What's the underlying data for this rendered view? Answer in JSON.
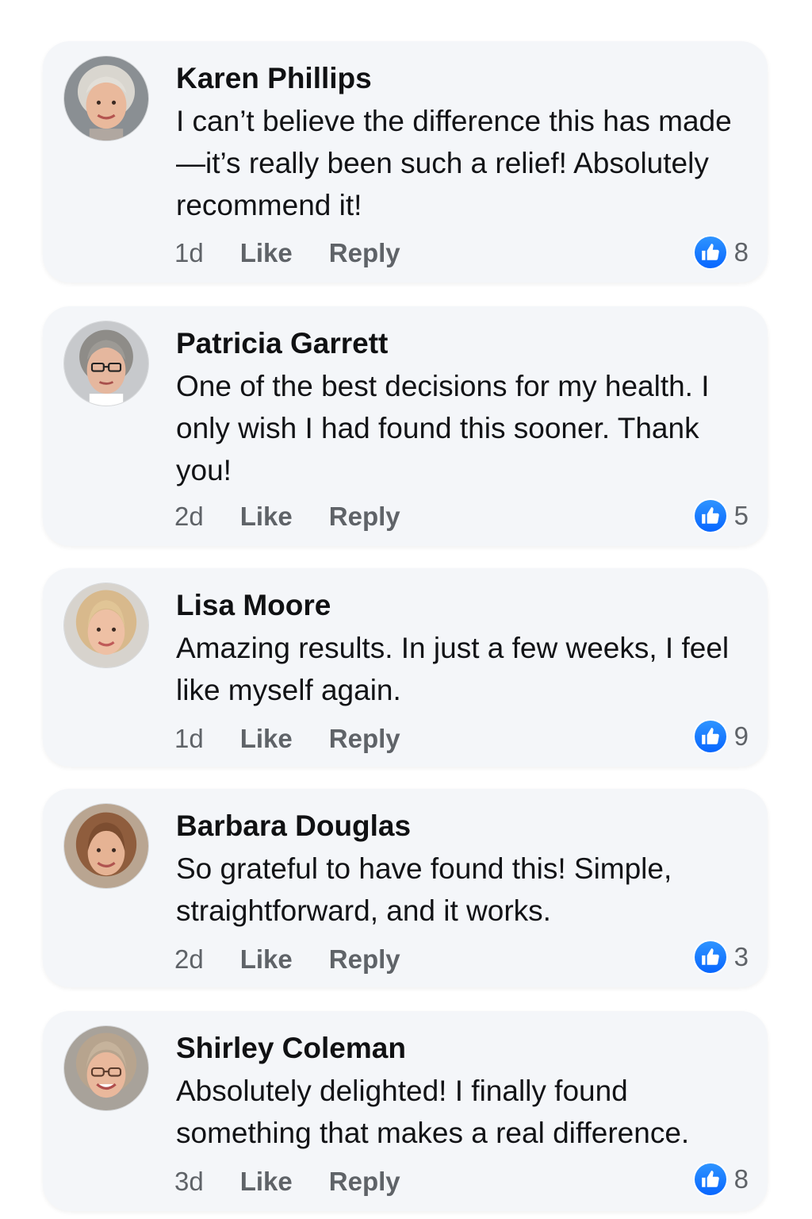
{
  "brand_colors": {
    "like_blue": "#0866ff",
    "card_background": "#f4f6f9",
    "meta_gray": "#5f6368"
  },
  "comments": [
    {
      "author": "Karen Phillips",
      "text": "I can’t believe the difference this has made—it’s really been such a relief! Absolutely recommend it!",
      "time": "1d",
      "like_label": "Like",
      "reply_label": "Reply",
      "reaction_icon": "thumbs-up-icon",
      "reaction_count": "8"
    },
    {
      "author": "Patricia Garrett",
      "text": "One of the best decisions for my health. I only wish I had found this sooner. Thank you!",
      "time": "2d",
      "like_label": "Like",
      "reply_label": "Reply",
      "reaction_icon": "thumbs-up-icon",
      "reaction_count": "5"
    },
    {
      "author": "Lisa Moore",
      "text": "Amazing results. In just a few weeks, I feel like myself again.",
      "time": "1d",
      "like_label": "Like",
      "reply_label": "Reply",
      "reaction_icon": "thumbs-up-icon",
      "reaction_count": "9"
    },
    {
      "author": "Barbara Douglas",
      "text": "So grateful to have found this! Simple, straightforward, and it works.",
      "time": "2d",
      "like_label": "Like",
      "reply_label": "Reply",
      "reaction_icon": "thumbs-up-icon",
      "reaction_count": "3"
    },
    {
      "author": "Shirley Coleman",
      "text": "Absolutely delighted! I finally found something that makes a real difference.",
      "time": "3d",
      "like_label": "Like",
      "reply_label": "Reply",
      "reaction_icon": "thumbs-up-icon",
      "reaction_count": "8"
    }
  ]
}
